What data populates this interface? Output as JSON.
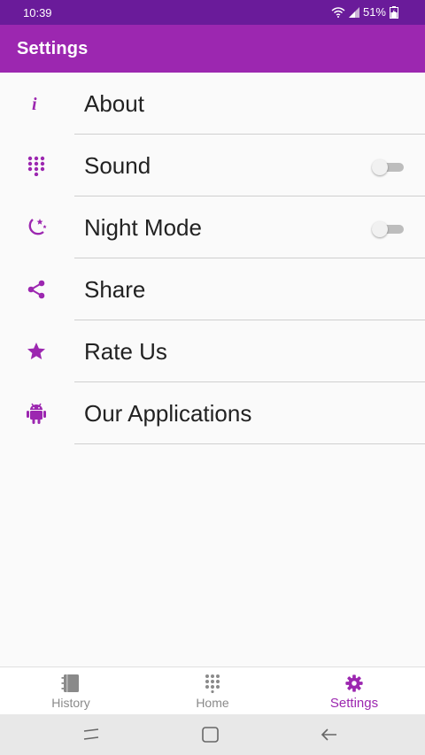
{
  "status": {
    "time": "10:39",
    "battery": "51%"
  },
  "app_bar": {
    "title": "Settings"
  },
  "settings": [
    {
      "label": "About",
      "icon": "info-icon",
      "toggle": null
    },
    {
      "label": "Sound",
      "icon": "dialpad-icon",
      "toggle": false
    },
    {
      "label": "Night Mode",
      "icon": "moon-stars-icon",
      "toggle": false
    },
    {
      "label": "Share",
      "icon": "share-icon",
      "toggle": null
    },
    {
      "label": "Rate Us",
      "icon": "star-icon",
      "toggle": null
    },
    {
      "label": "Our Applications",
      "icon": "android-icon",
      "toggle": null
    }
  ],
  "bottom_nav": [
    {
      "label": "History",
      "icon": "history-book-icon",
      "active": false
    },
    {
      "label": "Home",
      "icon": "dialpad-icon",
      "active": false
    },
    {
      "label": "Settings",
      "icon": "gear-icon",
      "active": true
    }
  ],
  "colors": {
    "accent": "#9c27b0",
    "status_bar": "#6a1b9a",
    "toggle_off": "#bdbdbd"
  }
}
